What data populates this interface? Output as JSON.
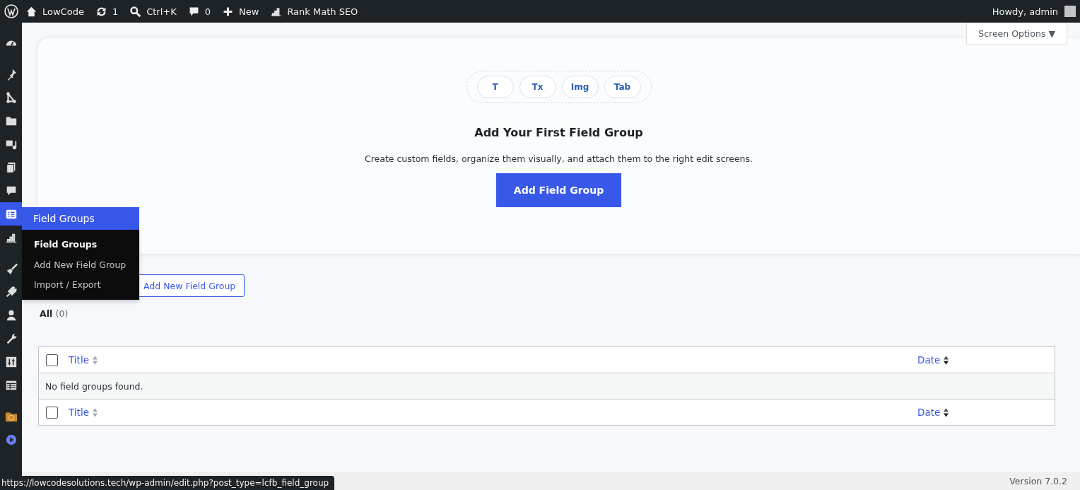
{
  "admin_bar": {
    "site": "LowCode",
    "updates": "1",
    "search": "Ctrl+K",
    "comments": "0",
    "new": "New",
    "seo": "Rank Math SEO",
    "greeting": "Howdy, admin"
  },
  "sidebar": {
    "items": [
      {
        "selected": false
      },
      {
        "selected": false
      },
      {
        "selected": false
      },
      {
        "selected": false
      },
      {
        "selected": false
      },
      {
        "selected": false
      },
      {
        "selected": false
      },
      {
        "selected": true
      },
      {
        "selected": false
      },
      {
        "selected": false
      },
      {
        "selected": false
      },
      {
        "selected": false
      },
      {
        "selected": false
      },
      {
        "selected": false
      },
      {
        "selected": false
      },
      {
        "selected": false
      },
      {
        "selected": false
      }
    ]
  },
  "flyout": {
    "title": "Field Groups",
    "items": [
      {
        "label": "Field Groups",
        "selected": true
      },
      {
        "label": "Add New Field Group",
        "selected": false
      },
      {
        "label": "Import / Export",
        "selected": false
      }
    ]
  },
  "screen_options": "Screen Options ▼",
  "empty_state": {
    "chips": [
      "T",
      "Tx",
      "Img",
      "Tab"
    ],
    "title": "Add Your First Field Group",
    "text": "Create custom fields, organize them visually, and attach them to the right edit screens.",
    "button": "Add Field Group"
  },
  "add_new_button": "Add New Field Group",
  "filters": [
    {
      "label": "All",
      "count": "(0)",
      "selected": true
    }
  ],
  "table": {
    "header_columns": [
      "Title",
      "Date"
    ],
    "footer_columns": [
      "Title",
      "Date"
    ],
    "empty": "No field groups found.",
    "header_checked": false,
    "footer_checked": false
  },
  "footer": {
    "version": "Version 7.0.2"
  },
  "status_url": "https://lowcodesolutions.tech/wp-admin/edit.php?post_type=lcfb_field_group"
}
